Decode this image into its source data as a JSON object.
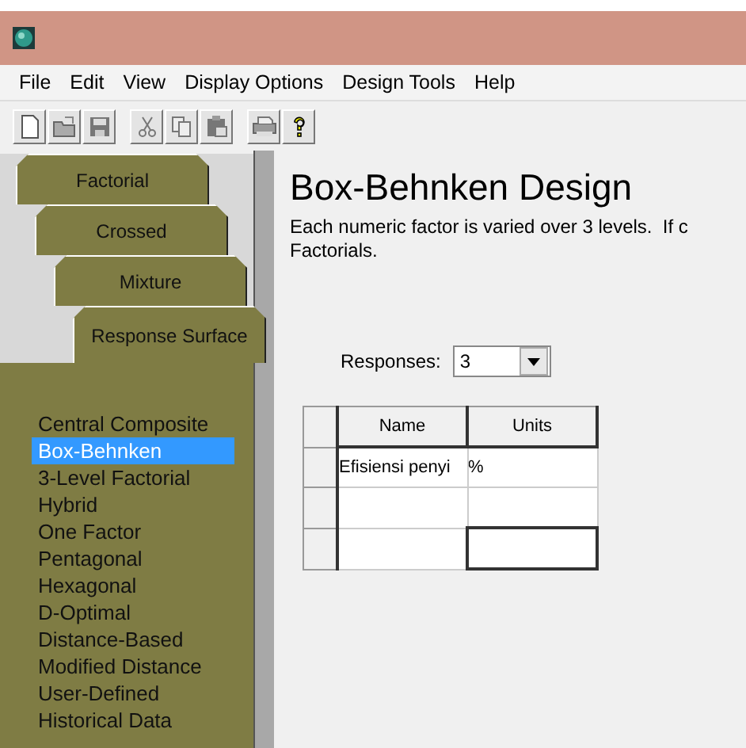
{
  "menu": [
    "File",
    "Edit",
    "View",
    "Display Options",
    "Design Tools",
    "Help"
  ],
  "toolbar": [
    {
      "kind": "new"
    },
    {
      "kind": "open"
    },
    {
      "kind": "save"
    },
    {
      "kind": "gap"
    },
    {
      "kind": "cut"
    },
    {
      "kind": "copy"
    },
    {
      "kind": "paste"
    },
    {
      "kind": "gap"
    },
    {
      "kind": "print"
    },
    {
      "kind": "help"
    }
  ],
  "tabs": [
    {
      "label": "Factorial",
      "selected": false
    },
    {
      "label": "Crossed",
      "selected": false
    },
    {
      "label": "Mixture",
      "selected": false
    },
    {
      "label": "Response Surface",
      "selected": true
    }
  ],
  "designs": [
    {
      "label": "Central Composite",
      "selected": false
    },
    {
      "label": "Box-Behnken",
      "selected": true
    },
    {
      "label": "3-Level Factorial",
      "selected": false
    },
    {
      "label": "Hybrid",
      "selected": false
    },
    {
      "label": "One Factor",
      "selected": false
    },
    {
      "label": "Pentagonal",
      "selected": false
    },
    {
      "label": "Hexagonal",
      "selected": false
    },
    {
      "label": "D-Optimal",
      "selected": false
    },
    {
      "label": "Distance-Based",
      "selected": false
    },
    {
      "label": "Modified Distance",
      "selected": false
    },
    {
      "label": "User-Defined",
      "selected": false
    },
    {
      "label": "Historical Data",
      "selected": false
    }
  ],
  "heading": "Box-Behnken Design",
  "description": [
    "Each numeric factor is varied over 3 levels.  If c",
    "Factorials."
  ],
  "responses": {
    "label": "Responses:",
    "value": "3"
  },
  "table": {
    "columns": [
      "Name",
      "Units"
    ],
    "rows": [
      {
        "name": "Efisiensi penyi",
        "units": "%",
        "focused": false
      },
      {
        "focused": false
      },
      {
        "focused": true
      }
    ]
  }
}
